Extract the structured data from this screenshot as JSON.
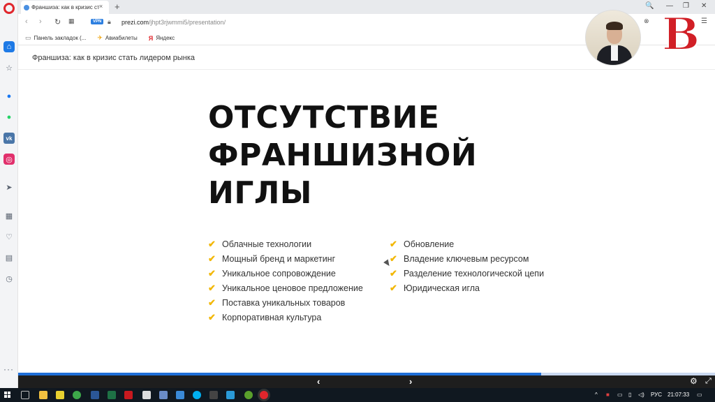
{
  "browser": {
    "tab": {
      "title": "Франшиза: как в кризис ст",
      "close": "×"
    },
    "new_tab": "+",
    "window_controls": [
      "🔍",
      "—",
      "❐",
      "✕"
    ],
    "address": {
      "vpn": "VPN",
      "url_host": "prezi.com",
      "url_path": "/jhpt3rjwmmi5/presentation/"
    },
    "bookmarks": [
      {
        "label": "Панель закладок (...",
        "icon": "folder-icon"
      },
      {
        "label": "Авиабилеты",
        "icon": "plane-icon"
      },
      {
        "label": "Яндекс",
        "icon": "yandex-icon"
      }
    ]
  },
  "page": {
    "header_title": "Франшиза: как в кризис стать лидером рынка"
  },
  "slide": {
    "heading_lines": [
      "ОТСУТСТВИЕ",
      "ФРАНШИЗНОЙ",
      "ИГЛЫ"
    ],
    "left_items": [
      "Облачные технологии",
      "Мощный бренд и маркетинг",
      "Уникальное сопровождение",
      "Уникальное ценовое предложение",
      "Поставка уникальных товаров",
      "Корпоративная культура"
    ],
    "right_items": [
      "Обновление",
      "Владение ключевым ресурсом",
      "Разделение технологической цепи",
      "Юридическая игла"
    ],
    "check_icon": "✔"
  },
  "presentation": {
    "progress": 0.75,
    "prev": "‹",
    "next": "›"
  },
  "overlay": {
    "logo_letter": "B"
  },
  "taskbar": {
    "language": "РУС",
    "time": "21:07:33"
  },
  "colors": {
    "accent_blue": "#1f6fd8",
    "check_yellow": "#f2b705",
    "opera_red": "#e0262c",
    "logo_red": "#d11f26"
  }
}
